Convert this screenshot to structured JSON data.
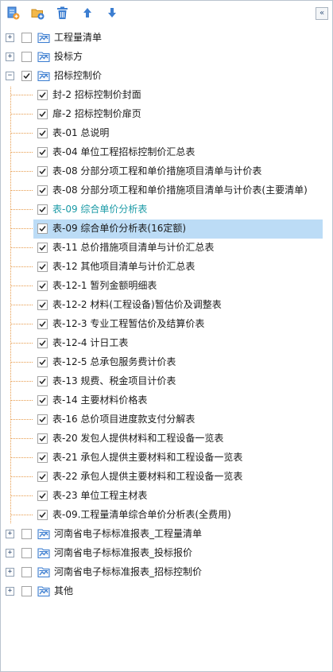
{
  "toolbar": {
    "buttons": [
      {
        "name": "add-document-icon"
      },
      {
        "name": "add-folder-icon"
      },
      {
        "name": "delete-icon"
      },
      {
        "name": "move-up-icon"
      },
      {
        "name": "move-down-icon"
      }
    ],
    "collapse_label": "«"
  },
  "colors": {
    "selection": "#bcdcf6",
    "tree_line": "#e79b4b",
    "highlight_text": "#1a9aa6",
    "icon_blue": "#3c7ed1"
  },
  "tree": {
    "roots": [
      {
        "label": "工程量清单",
        "expanded": false,
        "checked": false
      },
      {
        "label": "投标方",
        "expanded": false,
        "checked": false
      },
      {
        "label": "招标控制价",
        "expanded": true,
        "checked": true
      },
      {
        "label": "河南省电子标标准报表_工程量清单",
        "expanded": false,
        "checked": false
      },
      {
        "label": "河南省电子标标准报表_投标报价",
        "expanded": false,
        "checked": false
      },
      {
        "label": "河南省电子标标准报表_招标控制价",
        "expanded": false,
        "checked": false
      },
      {
        "label": "其他",
        "expanded": false,
        "checked": false
      }
    ],
    "children": [
      {
        "label": "封-2 招标控制价封面",
        "checked": true
      },
      {
        "label": "扉-2 招标控制价扉页",
        "checked": true
      },
      {
        "label": "表-01 总说明",
        "checked": true
      },
      {
        "label": "表-04 单位工程招标控制价汇总表",
        "checked": true
      },
      {
        "label": "表-08 分部分项工程和单价措施项目清单与计价表",
        "checked": true
      },
      {
        "label": "表-08 分部分项工程和单价措施项目清单与计价表(主要清单)",
        "checked": true
      },
      {
        "label": "表-09 综合单价分析表",
        "checked": true,
        "highlighted": true
      },
      {
        "label": "表-09 综合单价分析表(16定额)",
        "checked": true,
        "selected": true
      },
      {
        "label": "表-11 总价措施项目清单与计价汇总表",
        "checked": true
      },
      {
        "label": "表-12 其他项目清单与计价汇总表",
        "checked": true
      },
      {
        "label": "表-12-1 暂列金额明细表",
        "checked": true
      },
      {
        "label": "表-12-2 材料(工程设备)暂估价及调整表",
        "checked": true
      },
      {
        "label": "表-12-3 专业工程暂估价及结算价表",
        "checked": true
      },
      {
        "label": "表-12-4 计日工表",
        "checked": true
      },
      {
        "label": "表-12-5 总承包服务费计价表",
        "checked": true
      },
      {
        "label": "表-13 规费、税金项目计价表",
        "checked": true
      },
      {
        "label": "表-14 主要材料价格表",
        "checked": true
      },
      {
        "label": "表-16 总价项目进度款支付分解表",
        "checked": true
      },
      {
        "label": "表-20 发包人提供材料和工程设备一览表",
        "checked": true
      },
      {
        "label": "表-21 承包人提供主要材料和工程设备一览表",
        "checked": true
      },
      {
        "label": "表-22 承包人提供主要材料和工程设备一览表",
        "checked": true
      },
      {
        "label": "表-23 单位工程主材表",
        "checked": true
      },
      {
        "label": "表-09.工程量清单综合单价分析表(全费用)",
        "checked": true
      }
    ]
  }
}
